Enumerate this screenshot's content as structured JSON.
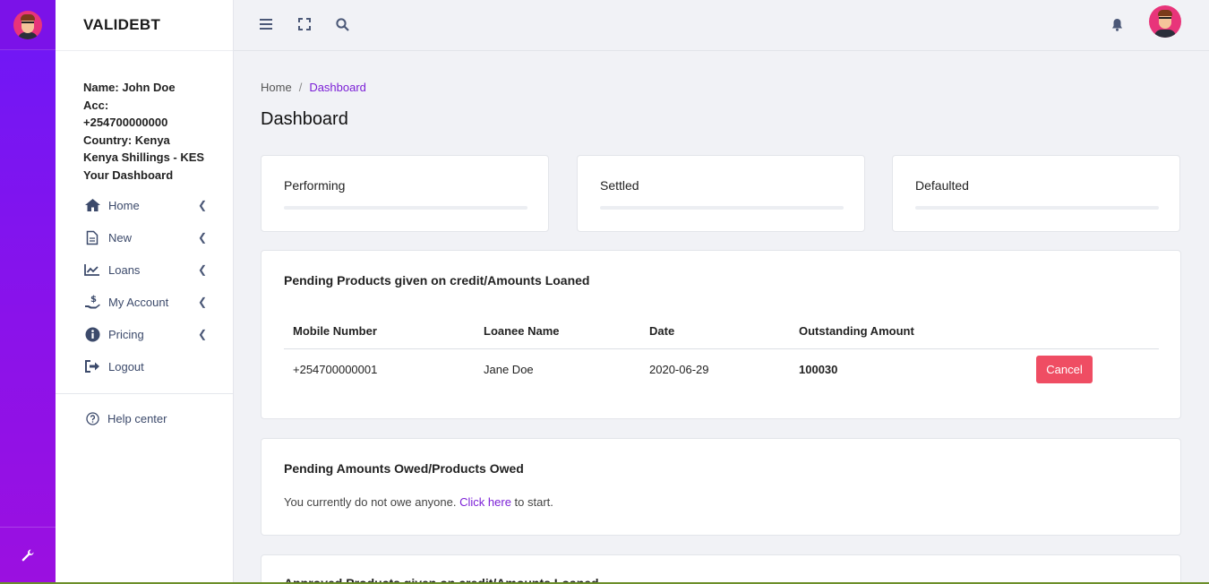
{
  "app": {
    "brand": "VALIDEBT"
  },
  "user": {
    "name_line": "Name: John Doe",
    "acc_label": "Acc:",
    "acc_number": "+254700000000",
    "country_line": "Country: Kenya",
    "currency_line": "Kenya Shillings - KES",
    "dashboard_line": "Your Dashboard"
  },
  "sidebar": {
    "items": [
      {
        "label": "Home",
        "icon": "home-icon",
        "has_submenu": true
      },
      {
        "label": "New",
        "icon": "document-icon",
        "has_submenu": true
      },
      {
        "label": "Loans",
        "icon": "chart-line-icon",
        "has_submenu": true
      },
      {
        "label": "My Account",
        "icon": "hand-money-icon",
        "has_submenu": true
      },
      {
        "label": "Pricing",
        "icon": "info-icon",
        "has_submenu": true
      },
      {
        "label": "Logout",
        "icon": "logout-icon",
        "has_submenu": false
      }
    ],
    "help_label": "Help center"
  },
  "breadcrumb": {
    "home": "Home",
    "current": "Dashboard"
  },
  "page_title": "Dashboard",
  "stats": [
    {
      "label": "Performing",
      "progress": 0
    },
    {
      "label": "Settled",
      "progress": 0
    },
    {
      "label": "Defaulted",
      "progress": 0
    }
  ],
  "pending_loans": {
    "title": "Pending Products given on credit/Amounts Loaned",
    "columns": [
      "Mobile Number",
      "Loanee Name",
      "Date",
      "Outstanding Amount"
    ],
    "rows": [
      {
        "mobile": "+254700000001",
        "name": "Jane Doe",
        "date": "2020-06-29",
        "amount": "100030",
        "action": "Cancel"
      }
    ]
  },
  "pending_owed": {
    "title": "Pending Amounts Owed/Products Owed",
    "text_before": "You currently do not owe anyone.",
    "link": "Click here",
    "text_after": "to start."
  },
  "approved_loans": {
    "title": "Approved Products given on credit/Amounts Loaned"
  },
  "colors": {
    "accent": "#7b1fd6",
    "danger": "#ef4d63",
    "rail_top": "#6d18f7",
    "rail_bottom": "#9b10e0"
  }
}
